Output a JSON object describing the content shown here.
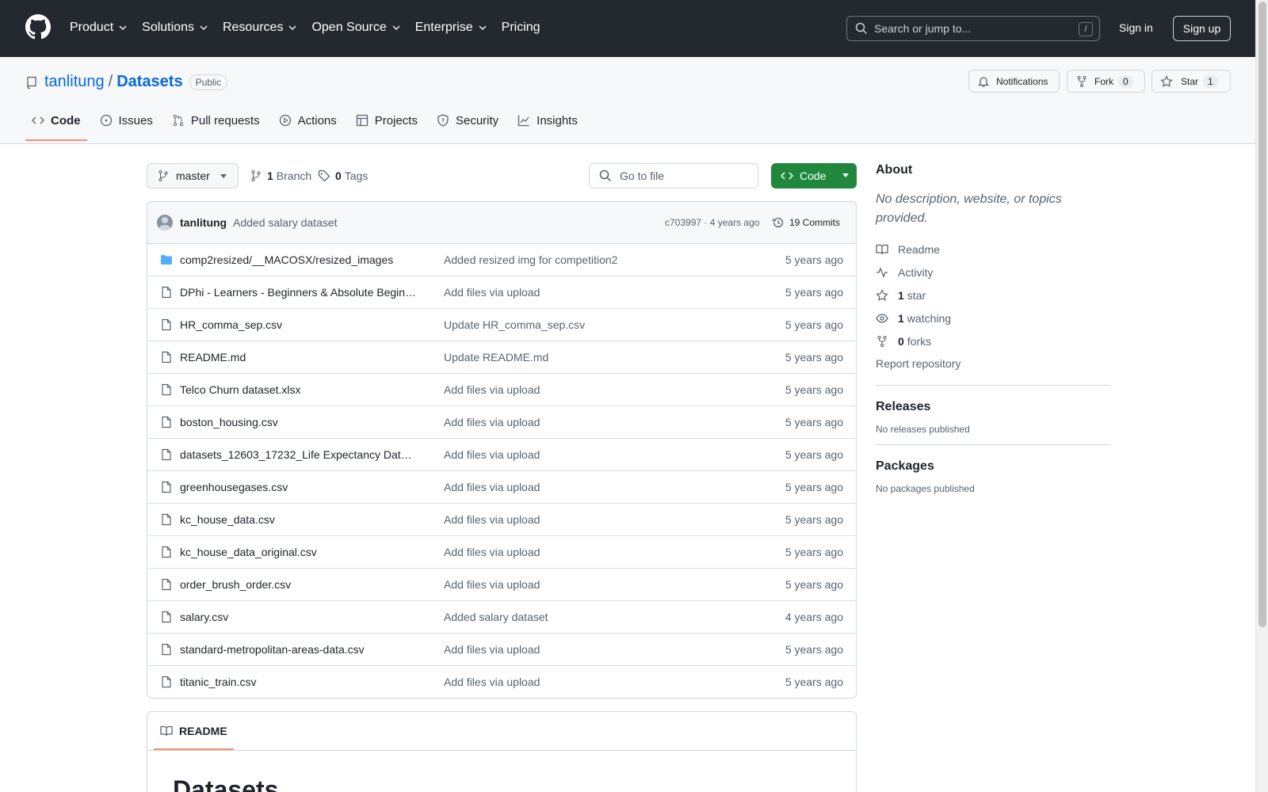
{
  "header": {
    "nav": [
      "Product",
      "Solutions",
      "Resources",
      "Open Source",
      "Enterprise",
      "Pricing"
    ],
    "search_placeholder": "Search or jump to...",
    "search_key": "/",
    "signin": "Sign in",
    "signup": "Sign up"
  },
  "repo": {
    "owner": "tanlitung",
    "sep": "/",
    "name": "Datasets",
    "visibility": "Public",
    "notifications": "Notifications",
    "fork_label": "Fork",
    "fork_count": "0",
    "star_label": "Star",
    "star_count": "1"
  },
  "tabs": [
    {
      "label": "Code",
      "icon": "code-icon"
    },
    {
      "label": "Issues",
      "icon": "issue-icon"
    },
    {
      "label": "Pull requests",
      "icon": "pull-request-icon"
    },
    {
      "label": "Actions",
      "icon": "play-icon"
    },
    {
      "label": "Projects",
      "icon": "table-icon"
    },
    {
      "label": "Security",
      "icon": "shield-icon"
    },
    {
      "label": "Insights",
      "icon": "graph-icon"
    }
  ],
  "toolbar": {
    "branch": "master",
    "branch_count": "1",
    "branch_label": "Branch",
    "tag_count": "0",
    "tag_label": "Tags",
    "goto_placeholder": "Go to file",
    "code_label": "Code"
  },
  "commit": {
    "author": "tanlitung",
    "message": "Added salary dataset",
    "hash_time": "c703997 · 4 years ago",
    "commits": "19 Commits"
  },
  "files": [
    {
      "type": "folder",
      "name": "comp2resized/__MACOSX/resized_images",
      "message": "Added resized img for competition2",
      "date": "5 years ago"
    },
    {
      "type": "file",
      "name": "DPhi - Learners - Beginners & Absolute Begin…",
      "message": "Add files via upload",
      "date": "5 years ago"
    },
    {
      "type": "file",
      "name": "HR_comma_sep.csv",
      "message": "Update HR_comma_sep.csv",
      "date": "5 years ago"
    },
    {
      "type": "file",
      "name": "README.md",
      "message": "Update README.md",
      "date": "5 years ago"
    },
    {
      "type": "file",
      "name": "Telco Churn dataset.xlsx",
      "message": "Add files via upload",
      "date": "5 years ago"
    },
    {
      "type": "file",
      "name": "boston_housing.csv",
      "message": "Add files via upload",
      "date": "5 years ago"
    },
    {
      "type": "file",
      "name": "datasets_12603_17232_Life Expectancy Dat…",
      "message": "Add files via upload",
      "date": "5 years ago"
    },
    {
      "type": "file",
      "name": "greenhousegases.csv",
      "message": "Add files via upload",
      "date": "5 years ago"
    },
    {
      "type": "file",
      "name": "kc_house_data.csv",
      "message": "Add files via upload",
      "date": "5 years ago"
    },
    {
      "type": "file",
      "name": "kc_house_data_original.csv",
      "message": "Add files via upload",
      "date": "5 years ago"
    },
    {
      "type": "file",
      "name": "order_brush_order.csv",
      "message": "Add files via upload",
      "date": "5 years ago"
    },
    {
      "type": "file",
      "name": "salary.csv",
      "message": "Added salary dataset",
      "date": "4 years ago"
    },
    {
      "type": "file",
      "name": "standard-metropolitan-areas-data.csv",
      "message": "Add files via upload",
      "date": "5 years ago"
    },
    {
      "type": "file",
      "name": "titanic_train.csv",
      "message": "Add files via upload",
      "date": "5 years ago"
    }
  ],
  "readme": {
    "tab": "README",
    "heading": "Datasets"
  },
  "about": {
    "title": "About",
    "description": "No description, website, or topics provided.",
    "readme": "Readme",
    "activity": "Activity",
    "stars_count": "1",
    "stars_label": "star",
    "watching_count": "1",
    "watching_label": "watching",
    "forks_count": "0",
    "forks_label": "forks",
    "report": "Report repository"
  },
  "releases": {
    "title": "Releases",
    "empty": "No releases published"
  },
  "packages": {
    "title": "Packages",
    "empty": "No packages published"
  },
  "colors": {
    "header_bg": "#24292f",
    "accent": "#0969da",
    "green": "#1f883d",
    "tab_underline": "#fd8c73"
  }
}
